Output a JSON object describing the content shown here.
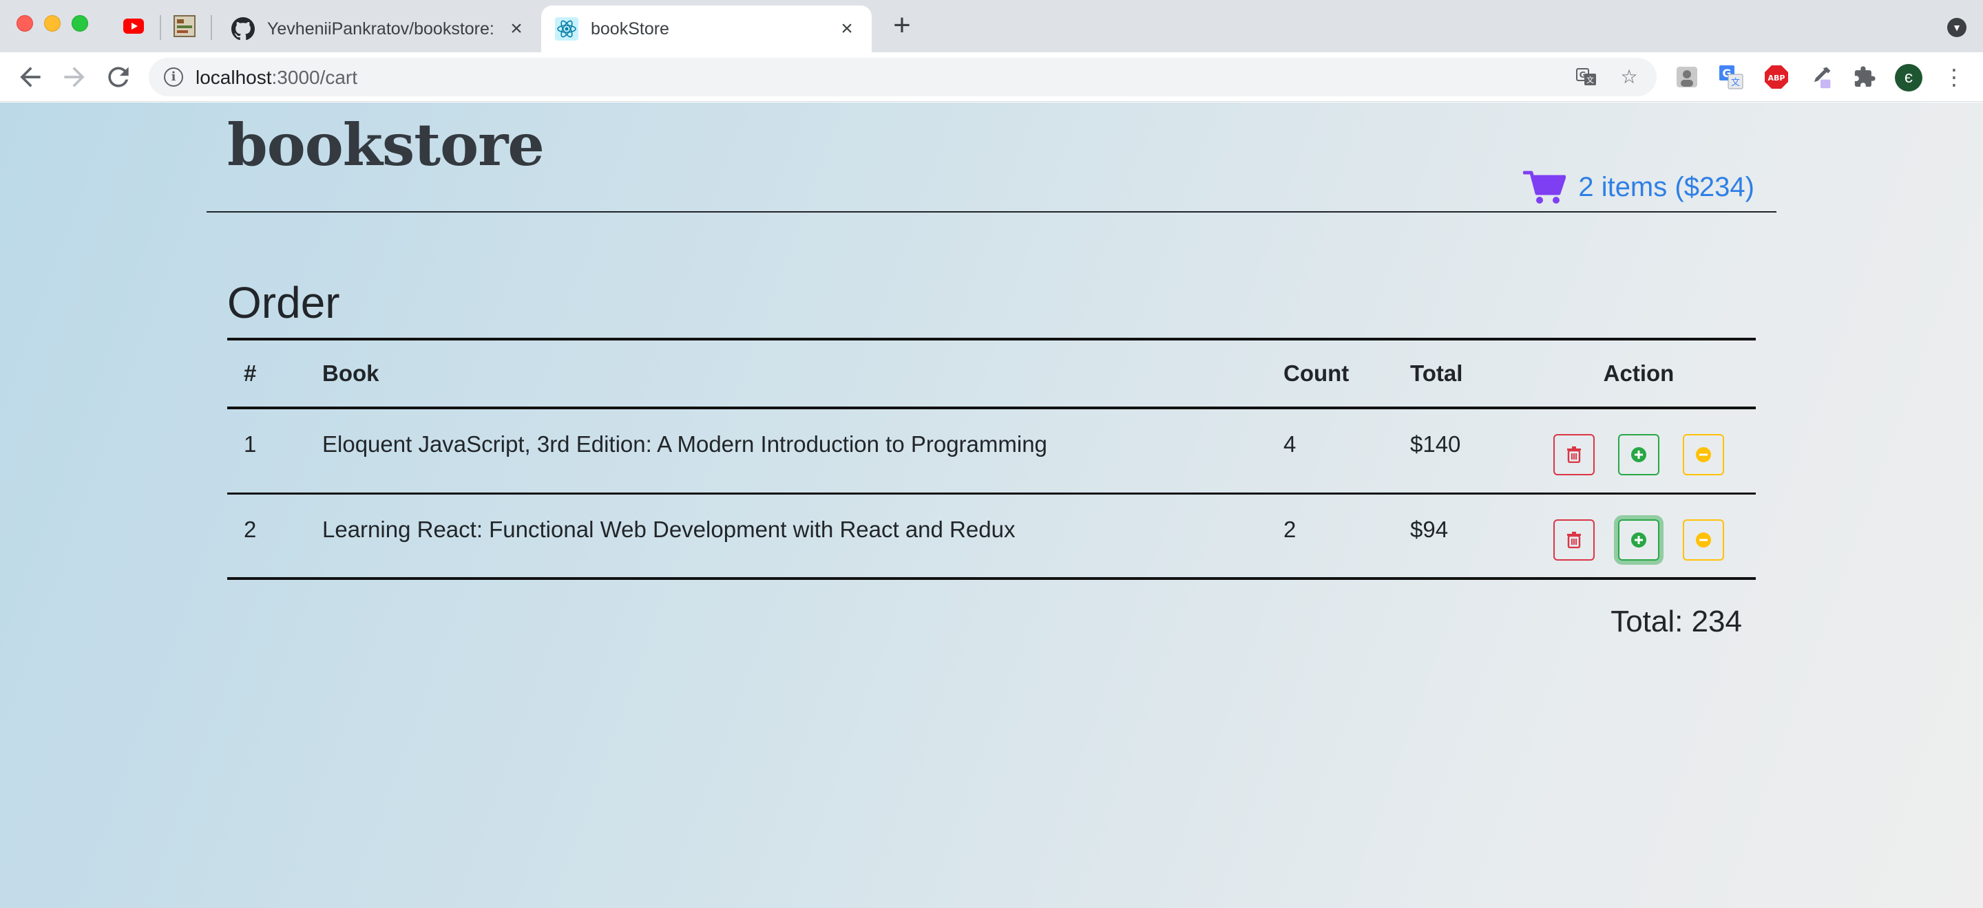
{
  "browser": {
    "tabs": [
      {
        "title": "YevheniiPankratov/bookstore: I",
        "active": false,
        "icon": "github-icon"
      },
      {
        "title": "bookStore",
        "active": true,
        "icon": "react-icon"
      }
    ],
    "pinned_tabs": [
      "youtube-icon",
      "image-thumbnail-icon"
    ],
    "url_host": "localhost",
    "url_path": ":3000/cart",
    "profile_initial": "є"
  },
  "site": {
    "brand": "bookstore",
    "cart_summary": "2 items ($234)",
    "accent_color": "#2f7fe5",
    "cart_icon_color": "#7e3ff2"
  },
  "order": {
    "title": "Order",
    "columns": {
      "num": "#",
      "book": "Book",
      "count": "Count",
      "total": "Total",
      "action": "Action"
    },
    "rows": [
      {
        "num": "1",
        "book": "Eloquent JavaScript, 3rd Edition: A Modern Introduction to Programming",
        "count": "4",
        "total": "$140"
      },
      {
        "num": "2",
        "book": "Learning React: Functional Web Development with React and Redux",
        "count": "2",
        "total": "$94"
      }
    ],
    "grand_total": "Total: 234"
  }
}
